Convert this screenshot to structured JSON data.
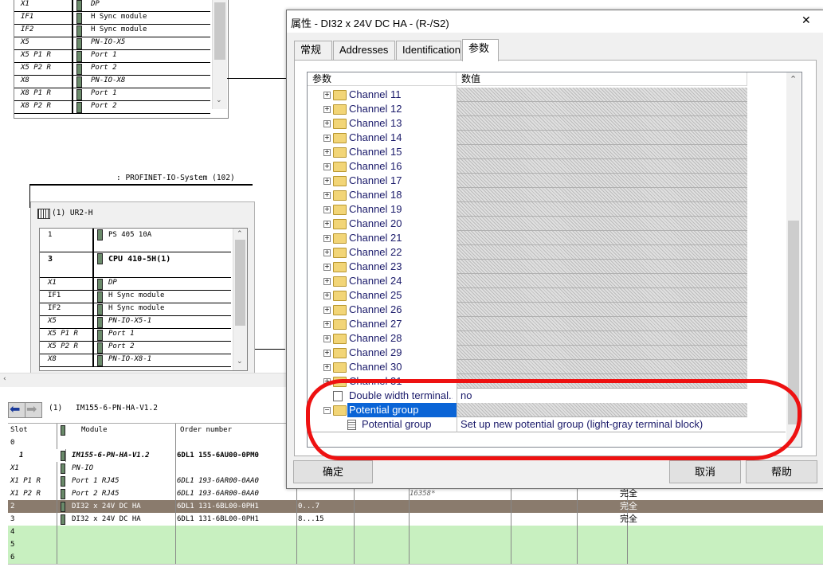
{
  "rack_top": {
    "rows": [
      {
        "slot": "X1",
        "module": "DP"
      },
      {
        "slot": "IF1",
        "module": "H Sync module"
      },
      {
        "slot": "IF2",
        "module": "H Sync module"
      },
      {
        "slot": "X5",
        "module": "PN-IO-X5"
      },
      {
        "slot": "X5 P1 R",
        "module": "Port 1"
      },
      {
        "slot": "X5 P2 R",
        "module": "Port 2"
      },
      {
        "slot": "X8",
        "module": "PN-IO-X8"
      },
      {
        "slot": "X8 P1 R",
        "module": "Port 1"
      },
      {
        "slot": "X8 P2 R",
        "module": "Port 2"
      }
    ]
  },
  "profinet_label": ": PROFINET-IO-System (102)",
  "rack_main": {
    "title": "(1) UR2-H",
    "rows": [
      {
        "slot": "1",
        "module": "PS 405 10A"
      },
      {
        "slot": "3",
        "module": "CPU 410-5H(1)"
      },
      {
        "slot": "X1",
        "module": "DP"
      },
      {
        "slot": "IF1",
        "module": "H Sync module"
      },
      {
        "slot": "IF2",
        "module": "H Sync module"
      },
      {
        "slot": "X5",
        "module": "PN-IO-X5-1"
      },
      {
        "slot": "X5 P1 R",
        "module": "Port 1"
      },
      {
        "slot": "X5 P2 R",
        "module": "Port 2"
      },
      {
        "slot": "X8",
        "module": "PN-IO-X8-1"
      }
    ]
  },
  "bottom": {
    "station_label": "(1)",
    "station_name": "IM155-6-PN-HA-V1.2",
    "headers": {
      "slot": "Slot",
      "module": "Module",
      "order": "Order number"
    },
    "rows": [
      {
        "slot": "0",
        "module": "",
        "order": "",
        "addr": "",
        "extra": "",
        "diag": ""
      },
      {
        "slot": "1",
        "module": "IM155-6-PN-HA-V1.2",
        "order": "6DL1 155-6AU00-0PM0",
        "addr": "",
        "extra": "",
        "diag": ""
      },
      {
        "slot": "X1",
        "module": "PN-IO",
        "order": "",
        "addr": "",
        "extra": "",
        "diag": ""
      },
      {
        "slot": "X1 P1 R",
        "module": "Port 1 RJ45",
        "order": "6DL1 193-6AR00-0AA0",
        "addr": "",
        "extra": "",
        "diag": ""
      },
      {
        "slot": "X1 P2 R",
        "module": "Port 2 RJ45",
        "order": "6DL1 193-6AR00-0AA0",
        "addr": "",
        "extra": "16358*",
        "diag": "完全"
      },
      {
        "slot": "2",
        "module": "DI32 x 24V DC HA",
        "order": "6DL1 131-6BL00-0PH1",
        "addr": "0...7",
        "extra": "",
        "diag": "完全"
      },
      {
        "slot": "3",
        "module": "DI32 x 24V DC HA",
        "order": "6DL1 131-6BL00-0PH1",
        "addr": "8...15",
        "extra": "",
        "diag": "完全"
      },
      {
        "slot": "4",
        "module": "",
        "order": "",
        "addr": "",
        "extra": "",
        "diag": ""
      },
      {
        "slot": "5",
        "module": "",
        "order": "",
        "addr": "",
        "extra": "",
        "diag": ""
      },
      {
        "slot": "6",
        "module": "",
        "order": "",
        "addr": "",
        "extra": "",
        "diag": ""
      }
    ]
  },
  "dialog": {
    "title": "属性 - DI32 x 24V DC HA - (R-/S2)",
    "close": "✕",
    "tabs": [
      "常规",
      "Addresses",
      "Identification",
      "参数"
    ],
    "active_tab": 3,
    "col_param": "参数",
    "col_value": "数值",
    "channels": [
      "Channel 11",
      "Channel 12",
      "Channel 13",
      "Channel 14",
      "Channel 15",
      "Channel 16",
      "Channel 17",
      "Channel 18",
      "Channel 19",
      "Channel 20",
      "Channel 21",
      "Channel 22",
      "Channel 23",
      "Channel 24",
      "Channel 25",
      "Channel 26",
      "Channel 27",
      "Channel 28",
      "Channel 29",
      "Channel 30",
      "Channel 31"
    ],
    "double_row": {
      "label": "Double width terminal...",
      "value": "no"
    },
    "potential_group_folder": "Potential group",
    "potential_group_item": {
      "label": "Potential group",
      "value": "Set up new potential group (light-gray terminal block)"
    },
    "buttons": {
      "ok": "确定",
      "cancel": "取消",
      "help": "帮助"
    }
  },
  "colors": {
    "annotation": "#ee1111",
    "selected_row": "#8a7b6d",
    "empty_row": "#c8f0c0",
    "tree_selected": "#0a64d6"
  }
}
